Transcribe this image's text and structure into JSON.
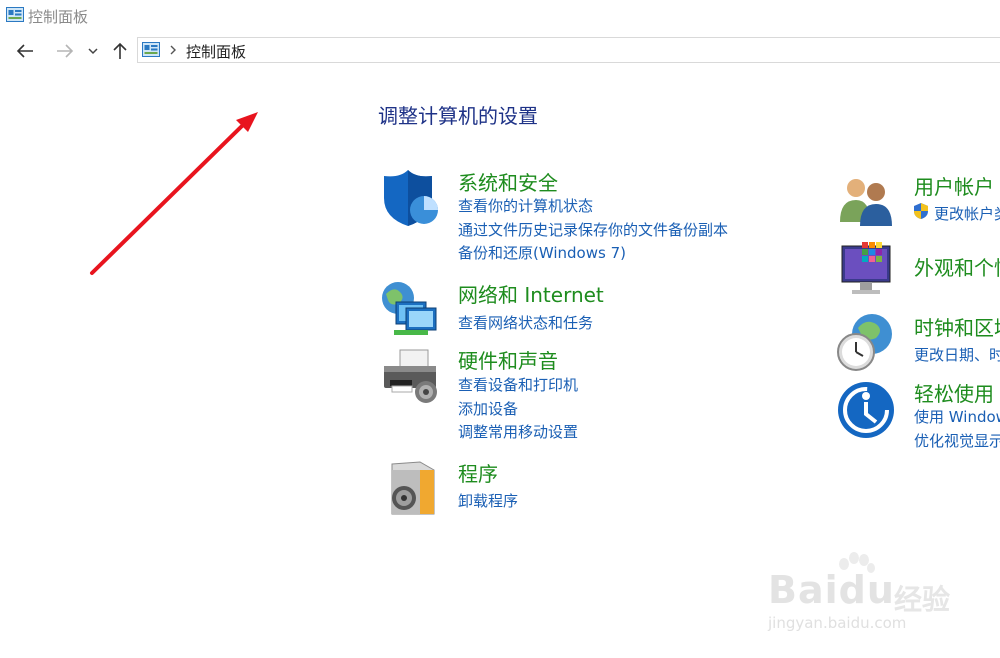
{
  "window": {
    "title": "控制面板"
  },
  "address": {
    "crumbs": [
      "控制面板"
    ]
  },
  "main": {
    "heading": "调整计算机的设置"
  },
  "categories": [
    {
      "title": "系统和安全",
      "icon": "shield-icon",
      "links": [
        "查看你的计算机状态",
        "通过文件历史记录保存你的文件备份副本",
        "备份和还原(Windows 7)"
      ]
    },
    {
      "title": "网络和 Internet",
      "icon": "network-icon",
      "links": [
        "查看网络状态和任务"
      ]
    },
    {
      "title": "硬件和声音",
      "icon": "printer-icon",
      "links": [
        "查看设备和打印机",
        "添加设备",
        "调整常用移动设置"
      ]
    },
    {
      "title": "程序",
      "icon": "programs-icon",
      "links": [
        "卸载程序"
      ]
    },
    {
      "title": "用户帐户",
      "icon": "users-icon",
      "links": [
        "更改帐户类"
      ]
    },
    {
      "title": "外观和个性",
      "icon": "appearance-icon",
      "links": []
    },
    {
      "title": "时钟和区域",
      "icon": "clock-globe-icon",
      "links": [
        "更改日期、时"
      ]
    },
    {
      "title": "轻松使用",
      "icon": "ease-of-access-icon",
      "links": [
        "使用 Windows",
        "优化视觉显示"
      ]
    }
  ],
  "watermark": {
    "logo": "Baidu",
    "cn": "经验",
    "url": "jingyan.baidu.com"
  },
  "colors": {
    "heading": "#1e3287",
    "category_title": "#1e8c1e",
    "link": "#1a5fb4",
    "arrow": "#e8141e"
  }
}
